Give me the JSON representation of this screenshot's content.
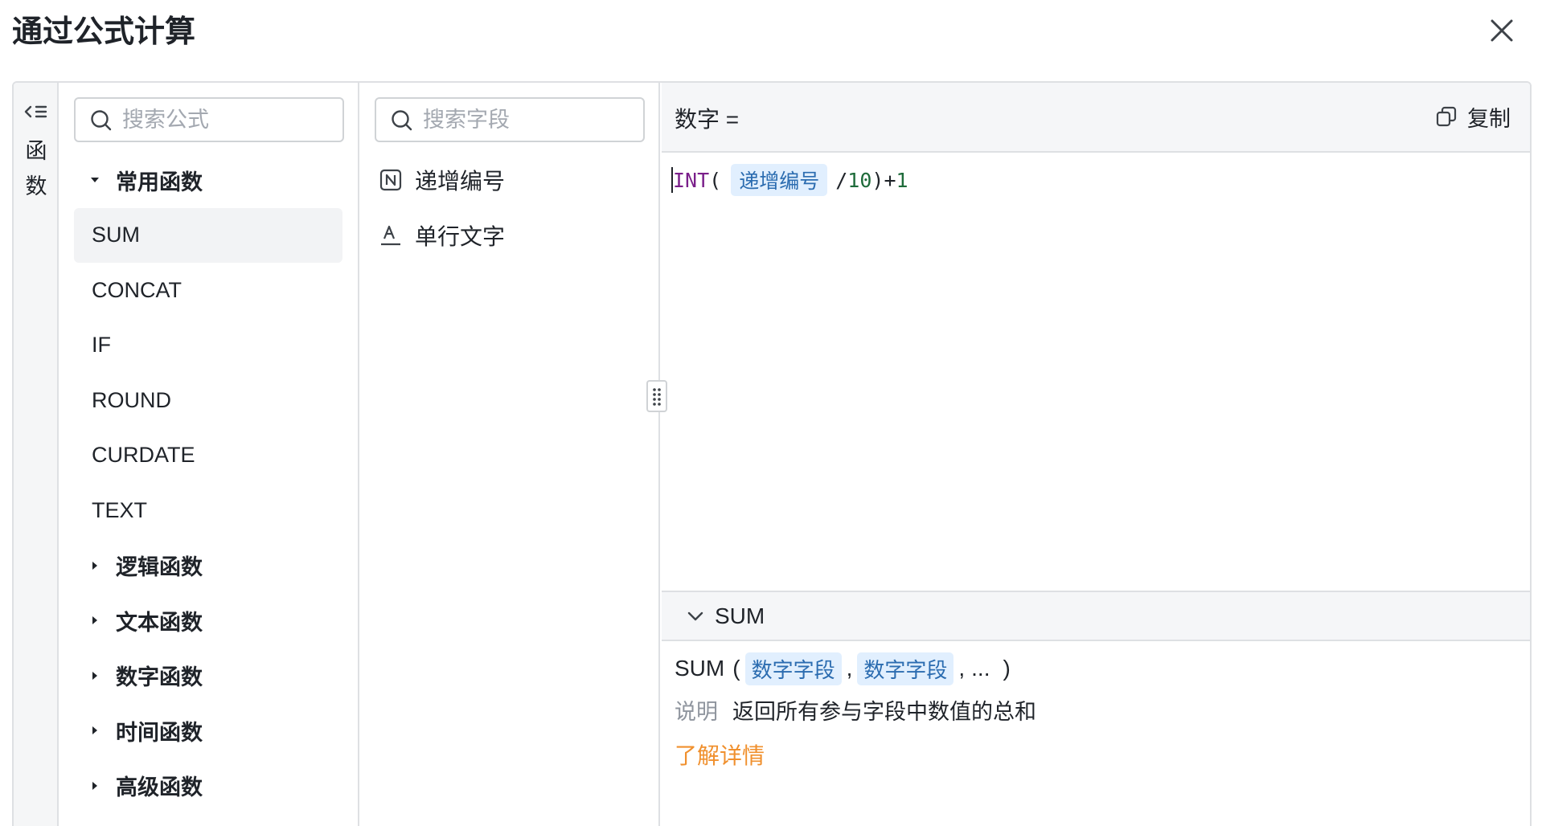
{
  "dialog": {
    "title": "通过公式计算"
  },
  "rail": {
    "label": "函数"
  },
  "functions": {
    "search_placeholder": "搜索公式",
    "groups": [
      {
        "label": "常用函数",
        "expanded": true,
        "items": [
          "SUM",
          "CONCAT",
          "IF",
          "ROUND",
          "CURDATE",
          "TEXT"
        ],
        "active_item": "SUM"
      },
      {
        "label": "逻辑函数",
        "expanded": false
      },
      {
        "label": "文本函数",
        "expanded": false
      },
      {
        "label": "数字函数",
        "expanded": false
      },
      {
        "label": "时间函数",
        "expanded": false
      },
      {
        "label": "高级函数",
        "expanded": false
      }
    ]
  },
  "fields": {
    "search_placeholder": "搜索字段",
    "items": [
      {
        "label": "递增编号",
        "icon": "autonumber-icon"
      },
      {
        "label": "单行文字",
        "icon": "text-field-icon"
      }
    ]
  },
  "editor": {
    "target_label": "数字 =",
    "copy_label": "复制",
    "formula": {
      "fn": "INT",
      "open": "(",
      "field": "递增编号",
      "op": "/",
      "num1": "10",
      "close": ")",
      "op2": "+",
      "num2": "1"
    }
  },
  "help": {
    "func_name": "SUM",
    "signature": {
      "name": "SUM",
      "open": "(",
      "arg1": "数字字段",
      "sep1": ",",
      "arg2": "数字字段",
      "sep2": ",",
      "rest": "...",
      "close": ")"
    },
    "desc_label": "说明",
    "desc_text": "返回所有参与字段中数值的总和",
    "more_link": "了解详情"
  },
  "colors": {
    "accent_link": "#f0902e",
    "chip_bg": "#e1effe",
    "chip_text": "#2b6cb0",
    "function_name": "#7a1f8a",
    "number": "#1e6b3a"
  }
}
